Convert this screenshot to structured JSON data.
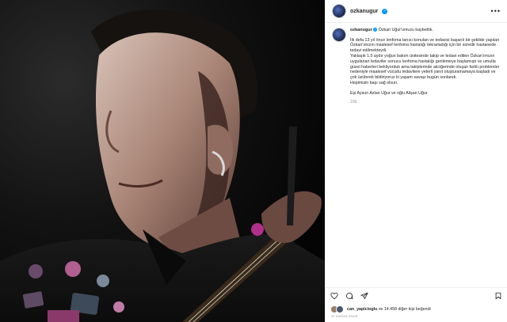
{
  "post": {
    "username": "ozkanugur",
    "verified_icon": "verified-badge-icon",
    "more_icon": "more-options-icon"
  },
  "caption": {
    "username": "ozkanugur",
    "headline": "Özkan Uğur'umuzu kaybettik.",
    "paragraph1": "İlk defa 13 yıl önce lenfoma tanısı konulan ve tedavisi başarılı bir şekilde yapılan Özkan'ımızın maalesef lenfoma hastalığı tekrarladığı için bir süredir hastanede tedavi edilmekteydi.",
    "paragraph2": "Yaklaşık 1.5 aydır yoğun bakım ünitesinde takip ve tedavi edilen Özkan'ımızın uygulanan tedaviler sonucu lenfoma hastalığı gerilemeye başlamıştı ve umutla güzel haberleri bekliyorduk ama takiplerinde akciğerinde oluşan farklı problemler nedeniyle maalesef vücudu tedavilere yeterli yanıt oluşturamamaya başladı ve çok üzülerek bildiriyoruz ki yaşam savaşı bugün sonlandı.",
    "paragraph3": "Hepimizin başı sağ olsun.",
    "signature": "Eşi Aysun Aslan Uğur ve oğlu Alişan Uğur",
    "time_ago": "10d"
  },
  "actions": {
    "icons": [
      "heart-icon",
      "comment-icon",
      "share-icon",
      "bookmark-icon"
    ]
  },
  "likes": {
    "user": "can_yapicioglu",
    "rest": " ve 14.458 diğer kişi beğendi"
  },
  "date": "10 DAKİKA ÖNCE",
  "colors": {
    "verified": "#0095f6",
    "text": "#262626",
    "muted": "#8e8e8e"
  }
}
